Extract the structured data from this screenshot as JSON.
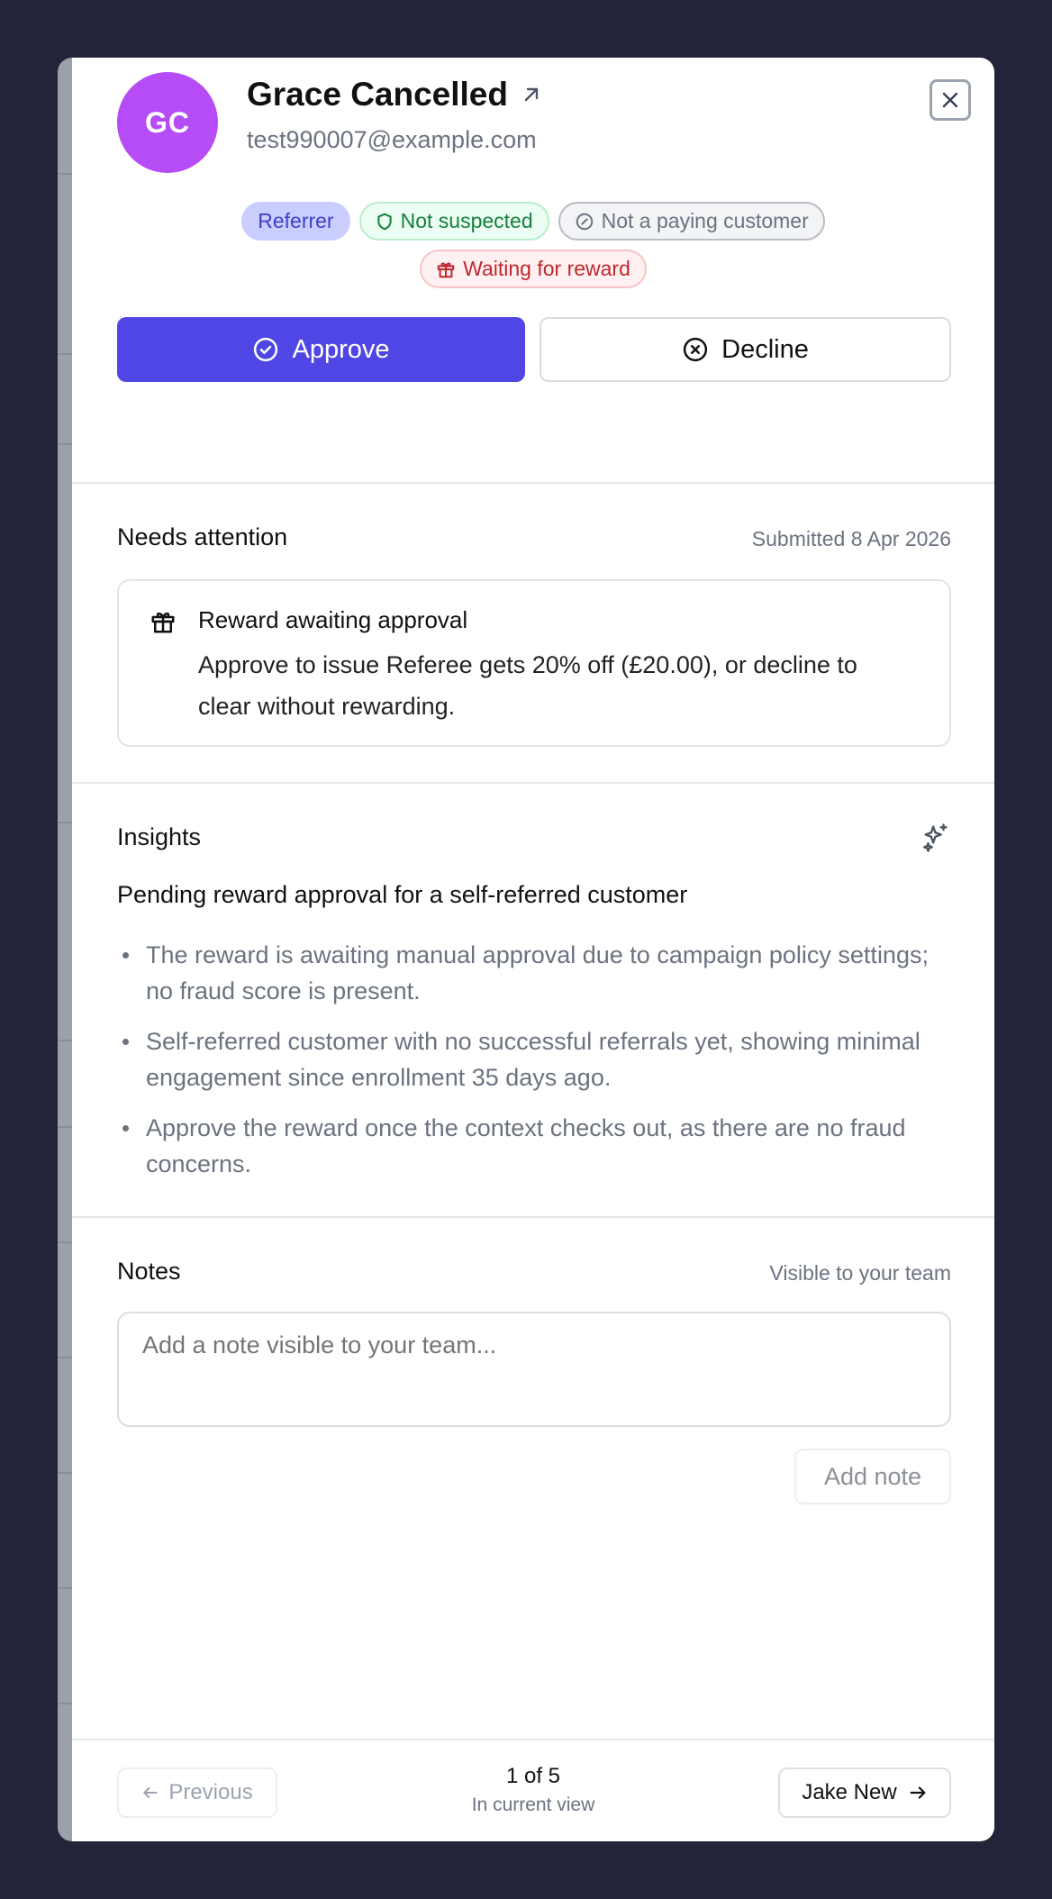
{
  "customer": {
    "initials": "GC",
    "name": "Grace Cancelled",
    "email": "test990007@example.com",
    "avatar_color": "#b54cf5"
  },
  "badges": {
    "role": "Referrer",
    "fraud": "Not suspected",
    "paying": "Not a paying customer",
    "reward_status": "Waiting for reward"
  },
  "actions": {
    "approve_label": "Approve",
    "decline_label": "Decline",
    "accent": "#4f46e5"
  },
  "attention": {
    "title": "Needs attention",
    "submitted": "Submitted 8 Apr 2026",
    "card_title": "Reward awaiting approval",
    "card_body": "Approve to issue Referee gets 20% off (£20.00), or decline to clear without rewarding."
  },
  "insights": {
    "title": "Insights",
    "headline": "Pending reward approval for a self-referred customer",
    "points": [
      "The reward is awaiting manual approval due to campaign policy settings; no fraud score is present.",
      "Self-referred customer with no successful referrals yet, showing minimal engagement since enrollment 35 days ago.",
      "Approve the reward once the context checks out, as there are no fraud concerns."
    ]
  },
  "notes": {
    "title": "Notes",
    "visibility": "Visible to your team",
    "placeholder": "Add a note visible to your team...",
    "add_label": "Add note"
  },
  "footer": {
    "previous_label": "Previous",
    "position": "1 of 5",
    "context": "In current view",
    "next_label": "Jake New"
  }
}
